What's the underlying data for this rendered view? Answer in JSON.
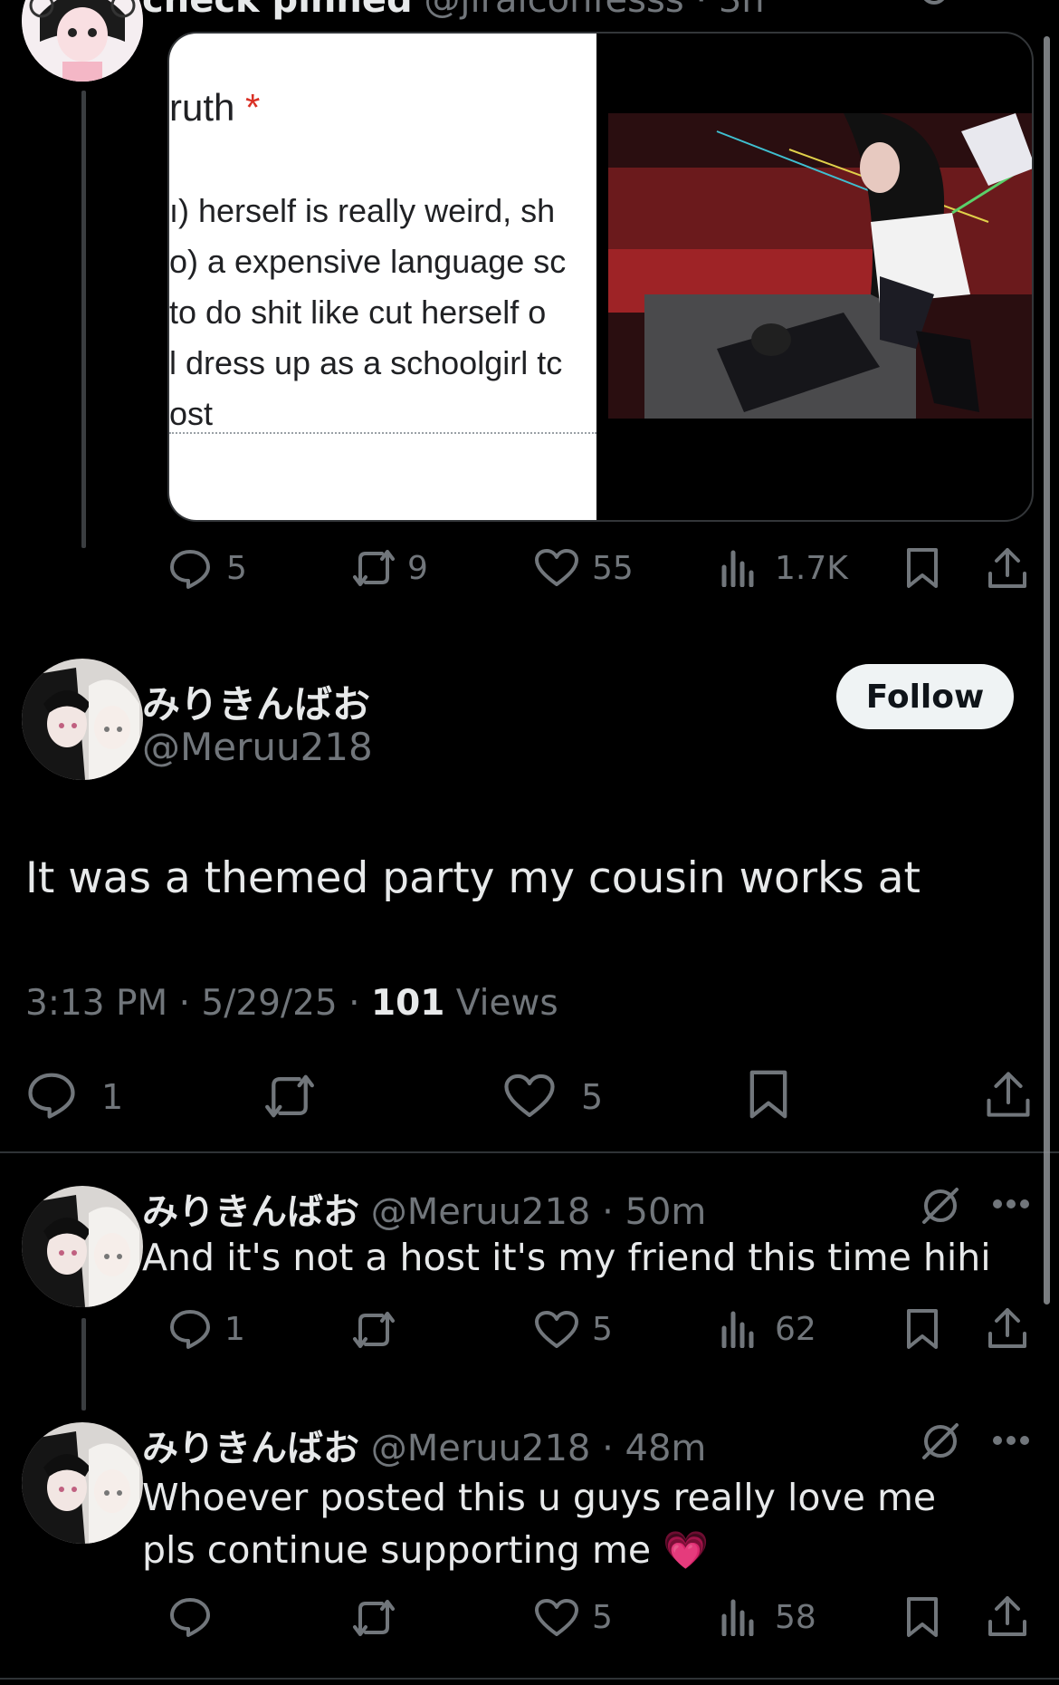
{
  "top_tweet": {
    "name_partial": "check pinned",
    "handle_partial": "@jiraiconfesss",
    "time_partial": "· 3h",
    "form_snippet": {
      "field_label": "ruth",
      "required_mark": "*",
      "lines": [
        "ı) herself is really weird, sh",
        "o) a expensive language sc",
        "to do shit like cut herself o",
        "l dress up as a schoolgirl tc",
        "ost"
      ]
    },
    "actions": {
      "replies": "5",
      "retweets": "9",
      "likes": "55",
      "views": "1.7K"
    }
  },
  "main_tweet": {
    "name": "みりきんばお",
    "handle": "@Meruu218",
    "follow_label": "Follow",
    "text": "It was a themed party my cousin works at",
    "time": "3:13 PM",
    "sep1": "·",
    "date": "5/29/25",
    "sep2": "·",
    "views_count": "101",
    "views_label": "Views",
    "actions": {
      "replies": "1",
      "likes": "5"
    }
  },
  "replies": [
    {
      "name": "みりきんばお",
      "handle": "@Meruu218",
      "time": "· 50m",
      "text": "And it's not a host it's my friend this time hihi",
      "actions": {
        "replies": "1",
        "likes": "5",
        "views": "62"
      }
    },
    {
      "name": "みりきんばお",
      "handle": "@Meruu218",
      "time": "· 48m",
      "text_line1": "Whoever posted this u guys really love me",
      "text_line2": "pls continue supporting me",
      "emoji": "💗",
      "actions": {
        "likes": "5",
        "views": "58"
      }
    }
  ],
  "colors": {
    "background": "#000000",
    "text": "#e7e9ea",
    "secondary": "#71767b",
    "follow_bg": "#eff3f4",
    "required_red": "#e0245e"
  }
}
